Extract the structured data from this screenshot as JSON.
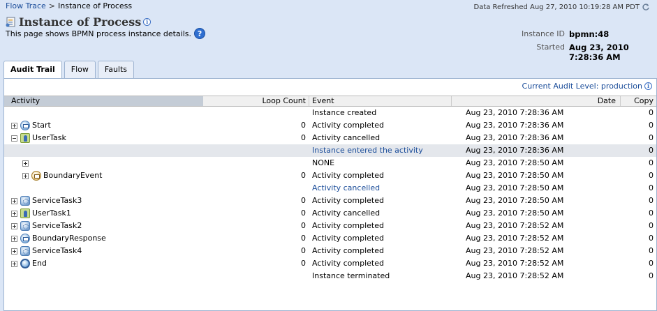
{
  "breadcrumb": {
    "root": "Flow Trace",
    "separator": ">",
    "current": "Instance of Process"
  },
  "refresh": {
    "text": "Data Refreshed Aug 27, 2010 10:19:28 AM PDT"
  },
  "page": {
    "title": "Instance of Process",
    "subtitle": "This page shows BPMN process instance details.",
    "help_glyph": "?",
    "info_glyph": "i"
  },
  "meta": {
    "instance_id_label": "Instance ID",
    "instance_id_value": "bpmn:48",
    "started_label": "Started",
    "started_value": "Aug 23, 2010 7:28:36 AM"
  },
  "tabs": [
    "Audit Trail",
    "Flow",
    "Faults"
  ],
  "active_tab": "Audit Trail",
  "audit_level": "Current Audit Level: production",
  "columns": {
    "activity": "Activity",
    "loop_count": "Loop Count",
    "event": "Event",
    "date": "Date",
    "copy": "Copy"
  },
  "rows": [
    {
      "indent": 0,
      "expander": "",
      "icon": "",
      "activity": "",
      "loop": "",
      "event": "Instance created",
      "event_link": false,
      "date": "Aug 23, 2010 7:28:36 AM",
      "copy": "0",
      "highlight": false
    },
    {
      "indent": 0,
      "expander": "plus",
      "icon": "message-start-event-icon",
      "activity": "Start",
      "loop": "0",
      "event": "Activity completed",
      "event_link": false,
      "date": "Aug 23, 2010 7:28:36 AM",
      "copy": "0",
      "highlight": false
    },
    {
      "indent": 0,
      "expander": "minus",
      "icon": "user-task-icon",
      "activity": "UserTask",
      "loop": "0",
      "event": "Activity cancelled",
      "event_link": false,
      "date": "Aug 23, 2010 7:28:36 AM",
      "copy": "0",
      "highlight": false
    },
    {
      "indent": 0,
      "expander": "",
      "icon": "",
      "activity": "",
      "loop": "",
      "event": "Instance entered the activity",
      "event_link": true,
      "date": "Aug 23, 2010 7:28:36 AM",
      "copy": "0",
      "highlight": true
    },
    {
      "indent": 1,
      "expander": "plus",
      "icon": "",
      "activity": "",
      "loop": "",
      "event": "NONE",
      "event_link": false,
      "date": "Aug 23, 2010 7:28:50 AM",
      "copy": "0",
      "highlight": false
    },
    {
      "indent": 1,
      "expander": "plus",
      "icon": "boundary-event-icon",
      "activity": "BoundaryEvent",
      "loop": "0",
      "event": "Activity completed",
      "event_link": false,
      "date": "Aug 23, 2010 7:28:50 AM",
      "copy": "0",
      "highlight": false
    },
    {
      "indent": 0,
      "expander": "",
      "icon": "",
      "activity": "",
      "loop": "",
      "event": "Activity cancelled",
      "event_link": true,
      "date": "Aug 23, 2010 7:28:50 AM",
      "copy": "0",
      "highlight": false
    },
    {
      "indent": 0,
      "expander": "plus",
      "icon": "service-task-icon",
      "activity": "ServiceTask3",
      "loop": "0",
      "event": "Activity completed",
      "event_link": false,
      "date": "Aug 23, 2010 7:28:50 AM",
      "copy": "0",
      "highlight": false
    },
    {
      "indent": 0,
      "expander": "plus",
      "icon": "user-task-icon",
      "activity": "UserTask1",
      "loop": "0",
      "event": "Activity cancelled",
      "event_link": false,
      "date": "Aug 23, 2010 7:28:50 AM",
      "copy": "0",
      "highlight": false
    },
    {
      "indent": 0,
      "expander": "plus",
      "icon": "service-task-icon",
      "activity": "ServiceTask2",
      "loop": "0",
      "event": "Activity completed",
      "event_link": false,
      "date": "Aug 23, 2010 7:28:52 AM",
      "copy": "0",
      "highlight": false
    },
    {
      "indent": 0,
      "expander": "plus",
      "icon": "message-event-icon",
      "activity": "BoundaryResponse",
      "loop": "0",
      "event": "Activity completed",
      "event_link": false,
      "date": "Aug 23, 2010 7:28:52 AM",
      "copy": "0",
      "highlight": false
    },
    {
      "indent": 0,
      "expander": "plus",
      "icon": "service-task-icon",
      "activity": "ServiceTask4",
      "loop": "0",
      "event": "Activity completed",
      "event_link": false,
      "date": "Aug 23, 2010 7:28:52 AM",
      "copy": "0",
      "highlight": false
    },
    {
      "indent": 0,
      "expander": "plus",
      "icon": "end-event-icon",
      "activity": "End",
      "loop": "0",
      "event": "Activity completed",
      "event_link": false,
      "date": "Aug 23, 2010 7:28:52 AM",
      "copy": "0",
      "highlight": false
    },
    {
      "indent": 0,
      "expander": "",
      "icon": "",
      "activity": "",
      "loop": "",
      "event": "Instance terminated",
      "event_link": false,
      "date": "Aug 23, 2010 7:28:52 AM",
      "copy": "0",
      "highlight": false
    }
  ]
}
